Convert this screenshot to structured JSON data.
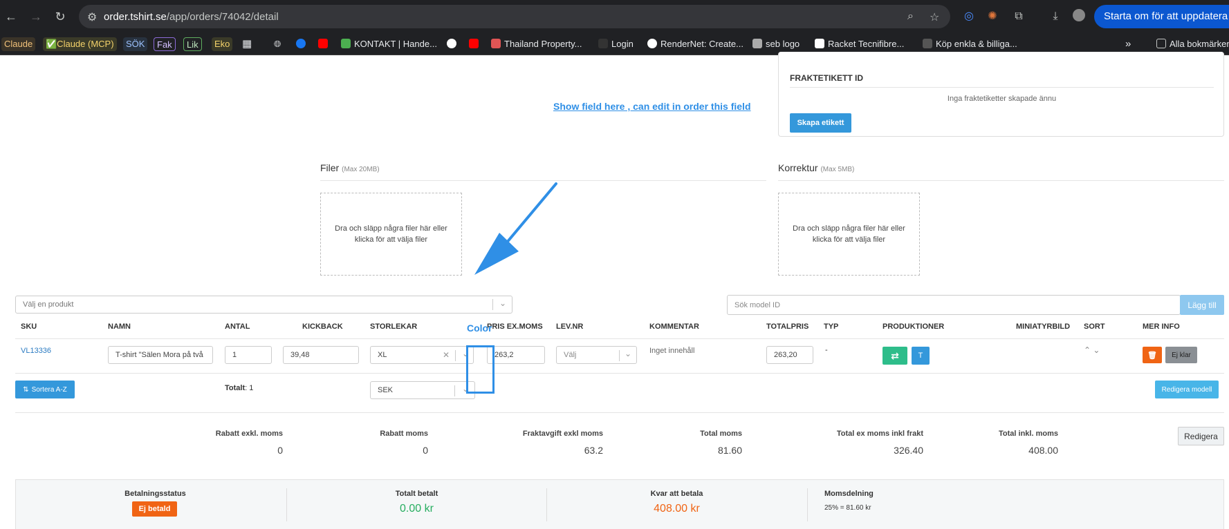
{
  "browser": {
    "url_host": "order.tshirt.se",
    "url_path": "/app/orders/74042/detail",
    "update_button": "Starta om för att uppdatera",
    "bookmarks": [
      {
        "label": "Claude",
        "color": "#d9a066"
      },
      {
        "label": "✅Claude (MCP)",
        "color": "#f5d36b"
      },
      {
        "label": "SÖK",
        "color": "#9ec3ff"
      },
      {
        "label": "Fak",
        "color": "#c7a8ff"
      },
      {
        "label": "Lik",
        "color": "#a8e6a8"
      },
      {
        "label": "Eko",
        "color": "#f5d36b"
      },
      {
        "label": "KONTAKT | Hande...",
        "color": "#4caf50"
      },
      {
        "label": "Thailand Property...",
        "color": "#e05555"
      },
      {
        "label": "Login",
        "color": "#333333"
      },
      {
        "label": "RenderNet: Create...",
        "color": "#ffffff"
      },
      {
        "label": "seb logo",
        "color": "#cccccc"
      },
      {
        "label": "Racket Tecnifibre...",
        "color": "#ffffff"
      },
      {
        "label": "Köp enkla & billiga...",
        "color": "#555555"
      }
    ],
    "all_bookmarks": "Alla bokmärken"
  },
  "shipping": {
    "label_id_header": "FRAKTETIKETT ID",
    "empty_text": "Inga fraktetiketter skapade ännu",
    "create_button": "Skapa etikett"
  },
  "annotation": {
    "note": "Show field here , can edit in order this field",
    "color_label": "Color"
  },
  "files": {
    "title": "Filer",
    "limit": "(Max 20MB)",
    "dropzone_text": "Dra och släpp några filer här eller klicka för att välja filer"
  },
  "proofs": {
    "title": "Korrektur",
    "limit": "(Max 5MB)",
    "dropzone_text": "Dra och släpp några filer här eller klicka för att välja filer"
  },
  "product_select": {
    "placeholder": "Välj en produkt"
  },
  "model_search": {
    "placeholder": "Sök model ID",
    "add_button": "Lägg till"
  },
  "table": {
    "headers": {
      "sku": "SKU",
      "name": "NAMN",
      "qty": "ANTAL",
      "kickback": "KICKBACK",
      "sizes": "STORLEKAR",
      "price": "PRIS EX.MOMS",
      "supplier": "LEV.NR",
      "comment": "KOMMENTAR",
      "total": "TOTALPRIS",
      "type": "TYP",
      "productions": "PRODUKTIONER",
      "thumbnail": "MINIATYRBILD",
      "sort": "SORT",
      "more": "MER INFO"
    },
    "row": {
      "sku": "VL13336",
      "name": "T-shirt \"Sälen Mora på två",
      "qty": "1",
      "kickback": "39,48",
      "size": "XL",
      "price": "263,2",
      "supplier": "Välj",
      "comment": "Inget innehåll",
      "total": "263,20",
      "type": "-",
      "prod_t_label": "T",
      "status_button": "Ej klar"
    },
    "sort_button": "Sortera A-Z",
    "total_label": "Totalt",
    "total_count": ": 1",
    "currency": "SEK",
    "edit_model_button": "Redigera modell"
  },
  "summary": {
    "items": [
      {
        "label": "Rabatt exkl. moms",
        "value": "0"
      },
      {
        "label": "Rabatt moms",
        "value": "0"
      },
      {
        "label": "Fraktavgift exkl moms",
        "value": "63.2"
      },
      {
        "label": "Total moms",
        "value": "81.60"
      },
      {
        "label": "Total ex moms inkl frakt",
        "value": "326.40"
      },
      {
        "label": "Total inkl. moms",
        "value": "408.00"
      }
    ],
    "edit_button": "Redigera"
  },
  "payment": {
    "status_label": "Betalningsstatus",
    "status_badge": "Ej betald",
    "paid_label": "Totalt betalt",
    "paid_value": "0.00 kr",
    "remaining_label": "Kvar att betala",
    "remaining_value": "408.00 kr",
    "vat_label": "Momsdelning",
    "vat_value": "25% = 81.60 kr"
  },
  "colors": {
    "accent_blue": "#3498db",
    "annotation_blue": "#2f8fe6",
    "orange": "#f06414",
    "green": "#27ae60",
    "teal": "#2ebd8a"
  }
}
